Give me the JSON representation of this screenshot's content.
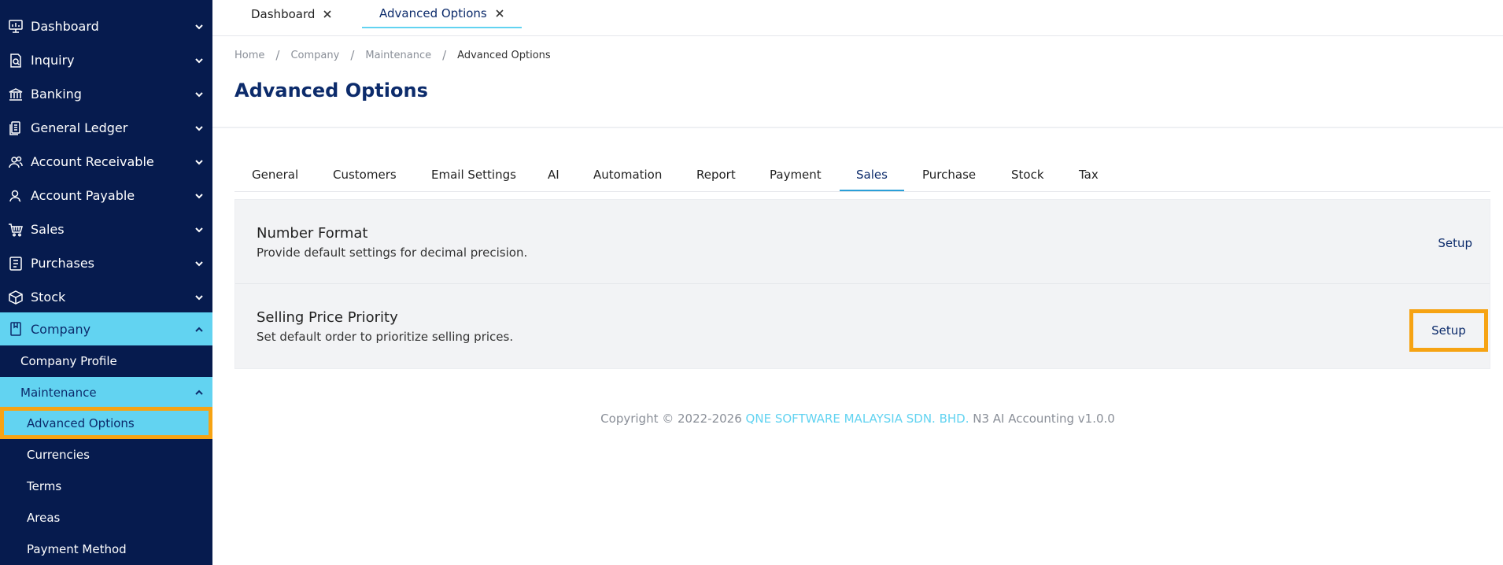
{
  "sidebar": {
    "items": [
      {
        "label": "Dashboard",
        "icon": "monitor-chart-icon"
      },
      {
        "label": "Inquiry",
        "icon": "document-search-icon"
      },
      {
        "label": "Banking",
        "icon": "bank-icon"
      },
      {
        "label": "General Ledger",
        "icon": "ledger-icon"
      },
      {
        "label": "Account Receivable",
        "icon": "users-icon"
      },
      {
        "label": "Account Payable",
        "icon": "user-icon"
      },
      {
        "label": "Sales",
        "icon": "cart-icon"
      },
      {
        "label": "Purchases",
        "icon": "receipt-icon"
      },
      {
        "label": "Stock",
        "icon": "box-icon"
      },
      {
        "label": "Company",
        "icon": "book-icon"
      }
    ],
    "company_sub": {
      "profile": "Company Profile",
      "maintenance": "Maintenance",
      "maintenance_items": [
        "Advanced Options",
        "Currencies",
        "Terms",
        "Areas",
        "Payment Method"
      ]
    }
  },
  "topbar": {
    "tabs": [
      {
        "label": "Dashboard"
      },
      {
        "label": "Advanced Options"
      }
    ]
  },
  "breadcrumb": {
    "items": [
      "Home",
      "Company",
      "Maintenance",
      "Advanced Options"
    ],
    "separator": "/"
  },
  "page": {
    "title": "Advanced Options"
  },
  "option_tabs": [
    "General",
    "Customers",
    "Email Settings",
    "AI",
    "Automation",
    "Report",
    "Payment",
    "Sales",
    "Purchase",
    "Stock",
    "Tax"
  ],
  "option_tabs_active": "Sales",
  "cards": [
    {
      "title": "Number Format",
      "desc": "Provide default settings for decimal precision.",
      "button": "Setup"
    },
    {
      "title": "Selling Price Priority",
      "desc": "Set default order to prioritize selling prices.",
      "button": "Setup"
    }
  ],
  "footer": {
    "prefix": "Copyright © 2022-2026",
    "brand": "QNE SOFTWARE MALAYSIA SDN. BHD.",
    "suffix": "N3 AI Accounting v1.0.0"
  },
  "colors": {
    "sidebar_bg": "#061b4e",
    "accent": "#62d3f1",
    "highlight": "#f6a313",
    "title": "#0c2b6b"
  }
}
